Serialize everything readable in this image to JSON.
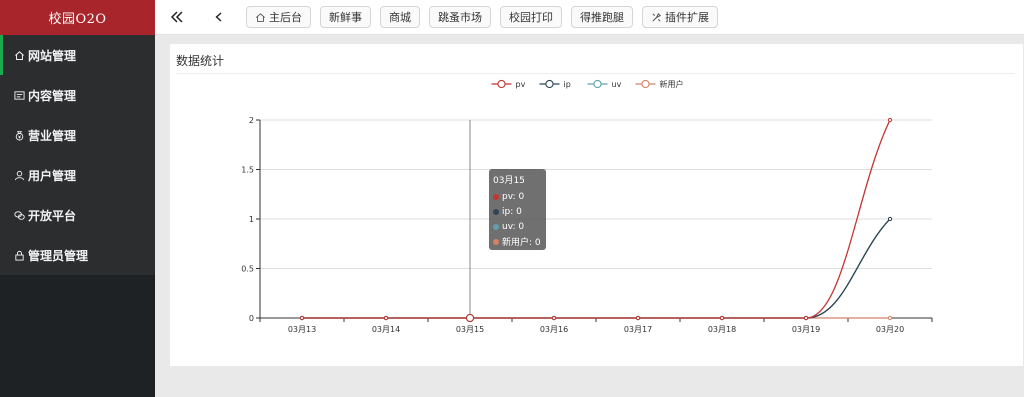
{
  "app": {
    "brand": "校园O2O"
  },
  "sidebar": {
    "items": [
      {
        "label": "网站管理",
        "icon": "home-icon",
        "active": true
      },
      {
        "label": "内容管理",
        "icon": "content-icon",
        "active": false
      },
      {
        "label": "营业管理",
        "icon": "money-bag-icon",
        "active": false
      },
      {
        "label": "用户管理",
        "icon": "user-icon",
        "active": false
      },
      {
        "label": "开放平台",
        "icon": "chat-icon",
        "active": false
      },
      {
        "label": "管理员管理",
        "icon": "lock-icon",
        "active": false
      }
    ]
  },
  "topbar": {
    "collapse_icon": "double-chevron-left-icon",
    "back_icon": "chevron-left-icon",
    "tabs": [
      {
        "label": "主后台",
        "icon": "home-icon"
      },
      {
        "label": "新鲜事"
      },
      {
        "label": "商城"
      },
      {
        "label": "跳蚤市场"
      },
      {
        "label": "校园打印"
      },
      {
        "label": "得推跑腿"
      },
      {
        "label": "插件扩展",
        "icon": "plugin-icon"
      }
    ]
  },
  "panel": {
    "title": "数据统计"
  },
  "tooltip": {
    "title": "03月15",
    "rows": [
      {
        "label": "pv: 0",
        "color": "#c23531"
      },
      {
        "label": "ip: 0",
        "color": "#2f4554"
      },
      {
        "label": "uv: 0",
        "color": "#61a0a8"
      },
      {
        "label": "新用户: 0",
        "color": "#d48265"
      }
    ]
  },
  "colors": {
    "brand": "#a8262b",
    "sidebar_bg": "#2b2d2f",
    "active_marker": "#1aa94c"
  },
  "chart_data": {
    "type": "line",
    "categories": [
      "03月13",
      "03月14",
      "03月15",
      "03月16",
      "03月17",
      "03月18",
      "03月19",
      "03月20"
    ],
    "series": [
      {
        "name": "pv",
        "values": [
          0,
          0,
          0,
          0,
          0,
          0,
          0,
          2
        ],
        "color": "#c23531"
      },
      {
        "name": "ip",
        "values": [
          0,
          0,
          0,
          0,
          0,
          0,
          0,
          1
        ],
        "color": "#2f4554"
      },
      {
        "name": "uv",
        "values": [
          0,
          0,
          0,
          0,
          0,
          0,
          0,
          1
        ],
        "color": "#61a0a8"
      },
      {
        "name": "新用户",
        "values": [
          0,
          0,
          0,
          0,
          0,
          0,
          0,
          0
        ],
        "color": "#d48265"
      }
    ],
    "ylim": [
      0,
      2
    ],
    "yticks": [
      "0",
      "0.5",
      "1",
      "1.5",
      "2"
    ],
    "grid": true,
    "smooth": true,
    "legend_position": "top-center",
    "highlighted_category": "03月15"
  }
}
